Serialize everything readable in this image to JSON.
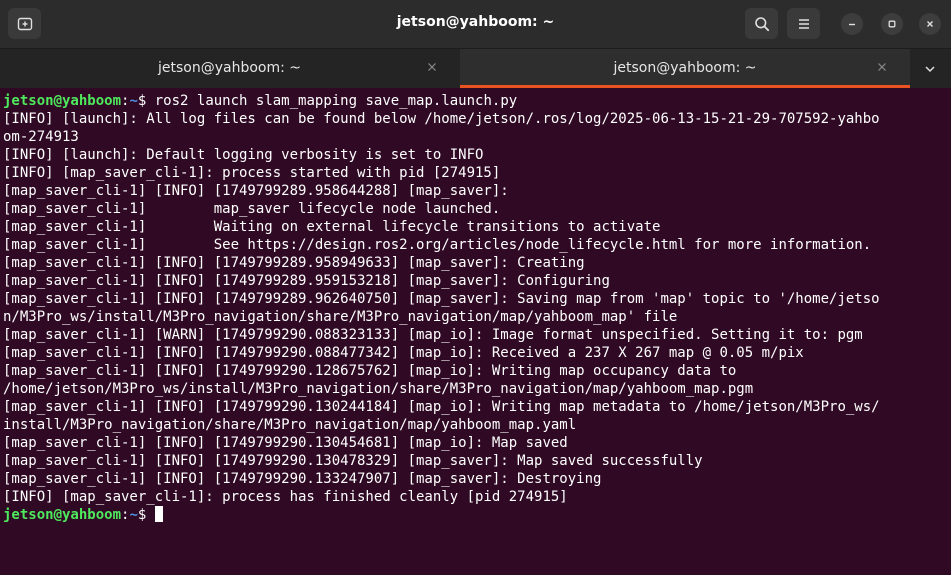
{
  "window": {
    "title": "jetson@yahboom: ~"
  },
  "tabs": [
    {
      "label": "jetson@yahboom: ~",
      "active": false
    },
    {
      "label": "jetson@yahboom: ~",
      "active": true
    }
  ],
  "icons": {
    "new_tab": "new-tab-icon",
    "search": "search-icon",
    "menu": "hamburger-menu-icon",
    "minimize": "minimize-icon",
    "maximize": "maximize-icon",
    "close": "close-icon",
    "tab_close": "close-icon",
    "tab_dropdown": "chevron-down-icon"
  },
  "colors": {
    "terminal_bg": "#300a24",
    "prompt_user": "#4ee95c",
    "prompt_path": "#4f8fe6",
    "active_tab_accent": "#e95420"
  },
  "terminal": {
    "prompt_user": "jetson@yahboom",
    "prompt_sep": ":",
    "prompt_path": "~",
    "prompt_symbol": "$ ",
    "command": "ros2 launch slam_mapping save_map.launch.py",
    "output_lines": [
      "[INFO] [launch]: All log files can be found below /home/jetson/.ros/log/2025-06-13-15-21-29-707592-yahbo",
      "om-274913",
      "[INFO] [launch]: Default logging verbosity is set to INFO",
      "[INFO] [map_saver_cli-1]: process started with pid [274915]",
      "[map_saver_cli-1] [INFO] [1749799289.958644288] [map_saver]:",
      "[map_saver_cli-1]        map_saver lifecycle node launched.",
      "[map_saver_cli-1]        Waiting on external lifecycle transitions to activate",
      "[map_saver_cli-1]        See https://design.ros2.org/articles/node_lifecycle.html for more information.",
      "[map_saver_cli-1] [INFO] [1749799289.958949633] [map_saver]: Creating",
      "[map_saver_cli-1] [INFO] [1749799289.959153218] [map_saver]: Configuring",
      "[map_saver_cli-1] [INFO] [1749799289.962640750] [map_saver]: Saving map from 'map' topic to '/home/jetso",
      "n/M3Pro_ws/install/M3Pro_navigation/share/M3Pro_navigation/map/yahboom_map' file",
      "[map_saver_cli-1] [WARN] [1749799290.088323133] [map_io]: Image format unspecified. Setting it to: pgm",
      "[map_saver_cli-1] [INFO] [1749799290.088477342] [map_io]: Received a 237 X 267 map @ 0.05 m/pix",
      "[map_saver_cli-1] [INFO] [1749799290.128675762] [map_io]: Writing map occupancy data to /home/jetson/M3Pro_ws/install/M3Pro_navigation/share/M3Pro_navigation/map/yahboom_map.pgm",
      "[map_saver_cli-1] [INFO] [1749799290.130244184] [map_io]: Writing map metadata to /home/jetson/M3Pro_ws/",
      "install/M3Pro_navigation/share/M3Pro_navigation/map/yahboom_map.yaml",
      "[map_saver_cli-1] [INFO] [1749799290.130454681] [map_io]: Map saved",
      "[map_saver_cli-1] [INFO] [1749799290.130478329] [map_saver]: Map saved successfully",
      "[map_saver_cli-1] [INFO] [1749799290.133247907] [map_saver]: Destroying",
      "[INFO] [map_saver_cli-1]: process has finished cleanly [pid 274915]"
    ]
  }
}
